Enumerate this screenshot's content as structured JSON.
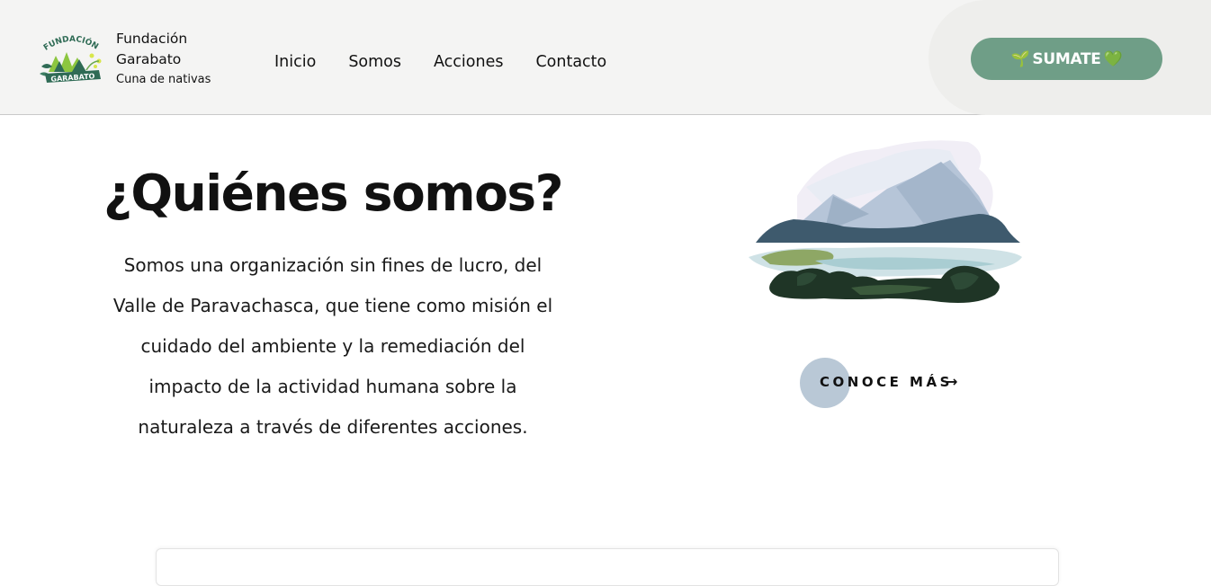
{
  "header": {
    "brand": {
      "line1": "Fundación",
      "line2": "Garabato",
      "tagline": "Cuna de nativas",
      "logo_text_top": "FUNDACIÓN",
      "logo_text_banner": "GARABATO"
    },
    "nav": [
      {
        "label": "Inicio"
      },
      {
        "label": "Somos"
      },
      {
        "label": "Acciones"
      },
      {
        "label": "Contacto"
      }
    ],
    "cta": {
      "label": "SUMATE",
      "icon_before": "🌱",
      "icon_after": "💚"
    }
  },
  "hero": {
    "title": "¿Quiénes somos?",
    "text_lines": [
      "Somos una organización sin fines de lucro, del",
      "Valle de Paravachasca, que tiene como misión el",
      "cuidado del ambiente y la remediación del",
      "impacto de la actividad humana sobre la",
      "naturaleza a través de diferentes acciones."
    ]
  },
  "more": {
    "label": "CONOCE MÁS",
    "arrow": "→"
  },
  "colors": {
    "header_bg": "#f4f4f3",
    "cta_bg": "#6f9e87",
    "more_circle": "#b9c8d6",
    "mountain_dark": "#3e5a6d",
    "logo_green": "#2f6b55"
  },
  "icons": {
    "logo": "fundacion-garabato-logo",
    "illustration": "mountain-lake-illustration",
    "arrow": "arrow-right-icon"
  }
}
